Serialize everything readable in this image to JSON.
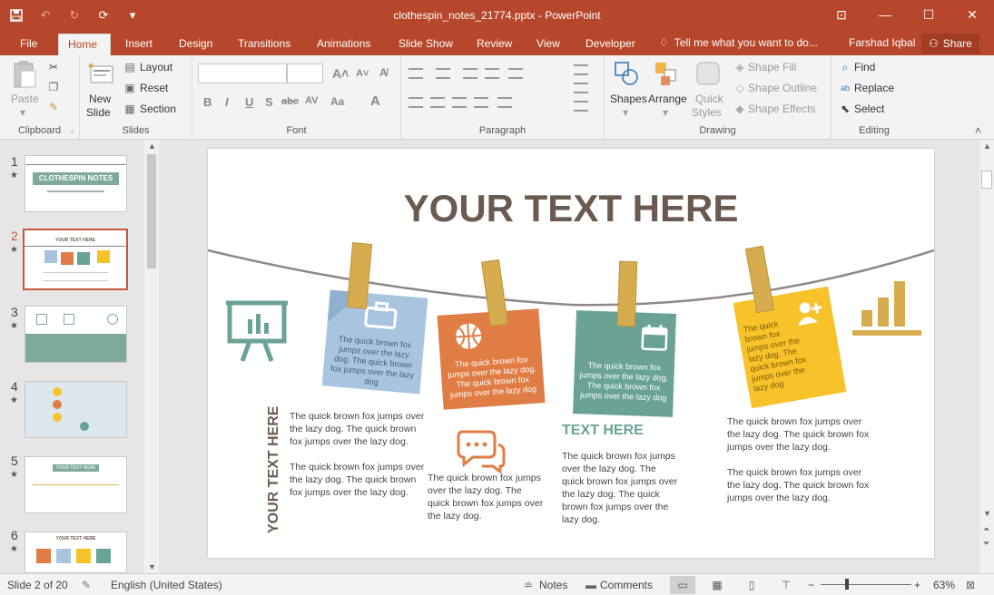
{
  "window": {
    "title": "clothespin_notes_21774.pptx - PowerPoint",
    "controls": [
      "⊡",
      "—",
      "☐",
      "✕"
    ]
  },
  "ribbon_tabs": {
    "file": "File",
    "home": "Home",
    "insert": "Insert",
    "design": "Design",
    "transitions": "Transitions",
    "animations": "Animations",
    "slide_show": "Slide Show",
    "review": "Review",
    "view": "View",
    "developer": "Developer",
    "tell_me": "Tell me what you want to do...",
    "user": "Farshad Iqbal",
    "share": "Share"
  },
  "ribbon": {
    "clipboard": {
      "label": "Clipboard",
      "paste": "Paste"
    },
    "slides": {
      "label": "Slides",
      "new_slide_1": "New",
      "new_slide_2": "Slide",
      "layout": "Layout",
      "reset": "Reset",
      "section": "Section"
    },
    "font": {
      "label": "Font",
      "bold": "B",
      "italic": "I",
      "underline": "U",
      "strike": "S",
      "shadow": "abc",
      "spacing": "AV",
      "case": "Aa",
      "color": "A"
    },
    "paragraph": {
      "label": "Paragraph"
    },
    "drawing": {
      "label": "Drawing",
      "shapes": "Shapes",
      "arrange": "Arrange",
      "quick_1": "Quick",
      "quick_2": "Styles",
      "shape_fill": "Shape Fill",
      "shape_outline": "Shape Outline",
      "shape_effects": "Shape Effects"
    },
    "editing": {
      "label": "Editing",
      "find": "Find",
      "replace": "Replace",
      "select": "Select"
    }
  },
  "thumbnails": [
    {
      "num": "1",
      "text": "CLOTHESPIN NOTES"
    },
    {
      "num": "2",
      "text": "YOUR TEXT HERE"
    },
    {
      "num": "3",
      "text": ""
    },
    {
      "num": "4",
      "text": ""
    },
    {
      "num": "5",
      "text": "YOUR TEXT HERE"
    },
    {
      "num": "6",
      "text": "YOUR TEXT HERE"
    }
  ],
  "slide": {
    "title": "YOUR TEXT HERE",
    "vertical_title": "YOUR TEXT HERE",
    "note_text": "The quick brown fox jumps over the lazy dog. The quick brown fox jumps over the lazy dog",
    "left_para_1": "The quick brown fox jumps over the lazy dog. The quick brown fox jumps over the lazy dog.",
    "left_para_2": "The quick brown fox jumps over the lazy dog. The quick brown fox jumps over the lazy dog.",
    "center_para": "The quick brown fox jumps over the lazy dog. The quick brown fox jumps over the lazy dog.",
    "teal_heading": "TEXT HERE",
    "teal_para": "The quick brown fox jumps over the lazy dog. The quick brown fox jumps over the lazy dog. The quick brown fox jumps over the lazy dog.",
    "right_para_1": "The quick brown fox jumps over the lazy dog. The quick brown fox jumps over the lazy dog.",
    "right_para_2": "The quick brown fox jumps over the lazy dog. The quick brown fox jumps over the lazy dog."
  },
  "status": {
    "slide_of": "Slide 2 of 20",
    "language": "English (United States)",
    "notes": "Notes",
    "comments": "Comments",
    "zoom_minus": "−",
    "zoom_plus": "+",
    "zoom": "63%",
    "zoom_value": 0.63
  },
  "colors": {
    "accent": "#b7472a",
    "blue_note": "#a9c4de",
    "orange_note": "#e07d45",
    "teal_note": "#6aa396",
    "yellow_note": "#f7c22a",
    "pin": "#d6ac4f",
    "title": "#6b5a50"
  }
}
